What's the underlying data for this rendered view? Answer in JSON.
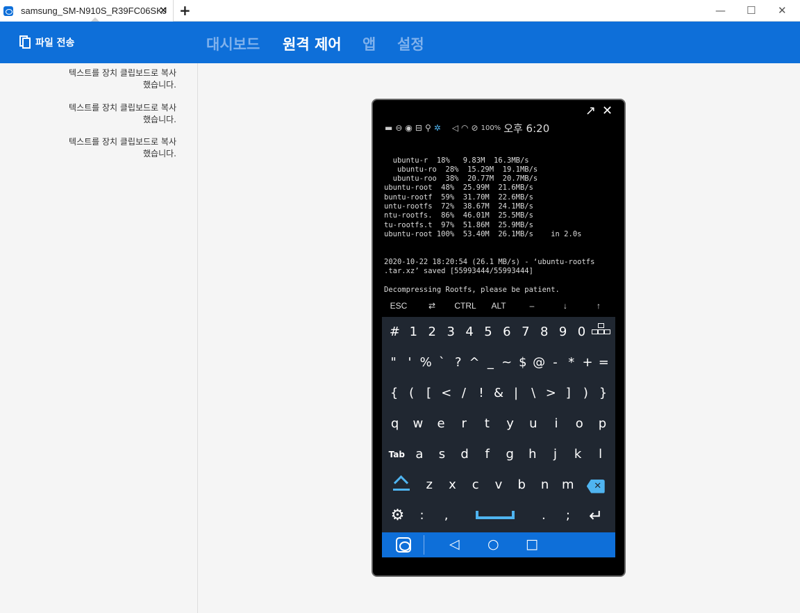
{
  "window": {
    "tab_title": "samsung_SM-N910S_R39FC06SKJ",
    "tab_close": "✕",
    "new_tab": "+",
    "minimize": "—",
    "maximize": "☐",
    "close": "✕"
  },
  "header": {
    "file_transfer_label": "파일 전송",
    "nav": [
      "대시보드",
      "원격 제어",
      "앱",
      "설정"
    ],
    "active_nav": "원격 제어"
  },
  "left_panel": {
    "messages": [
      {
        "line1": "텍스트를 장치 클립보드로 복사",
        "line2": "했습니다."
      },
      {
        "line1": "텍스트를 장치 클립보드로 복사",
        "line2": "했습니다."
      },
      {
        "line1": "텍스트를 장치 클립보드로 복사",
        "line2": "했습니다."
      }
    ]
  },
  "phone": {
    "popout": "↗",
    "close": "✕",
    "status": {
      "battery": "100%",
      "time": "오후 6:20"
    },
    "terminal_lines": [
      "  ubuntu-r  18%   9.83M  16.3MB/s",
      "   ubuntu-ro  28%  15.29M  19.1MB/s",
      "  ubuntu-roo  38%  20.77M  20.7MB/s",
      "ubuntu-root  48%  25.99M  21.6MB/s",
      "buntu-rootf  59%  31.70M  22.6MB/s",
      "untu-rootfs  72%  38.67M  24.1MB/s",
      "ntu-rootfs.  86%  46.01M  25.5MB/s",
      "tu-rootfs.t  97%  51.86M  25.9MB/s",
      "ubuntu-root 100%  53.40M  26.1MB/s    in 2.0s",
      "",
      "",
      "2020-10-22 18:20:54 (26.1 MB/s) - ‘ubuntu-rootfs",
      ".tar.xz’ saved [55993444/55993444]",
      "",
      "Decompressing Rootfs, please be patient."
    ],
    "extra_keys": [
      "ESC",
      "⇄",
      "CTRL",
      "ALT",
      "–",
      "↓",
      "↑"
    ],
    "keyboard": {
      "row1": [
        "#",
        "1",
        "2",
        "3",
        "4",
        "5",
        "6",
        "7",
        "8",
        "9",
        "0"
      ],
      "row2": [
        "\"",
        "'",
        "%",
        "`",
        "?",
        "^",
        "_",
        "~",
        "$",
        "@",
        "-",
        "*",
        "+",
        "="
      ],
      "row3": [
        "{",
        "(",
        "[",
        "<",
        "/",
        "!",
        "&",
        "|",
        "\\",
        ">",
        "]",
        ")",
        "}"
      ],
      "row4": [
        "q",
        "w",
        "e",
        "r",
        "t",
        "y",
        "u",
        "i",
        "o",
        "p"
      ],
      "row5_tab": "Tab",
      "row5": [
        "a",
        "s",
        "d",
        "f",
        "g",
        "h",
        "j",
        "k",
        "l"
      ],
      "row6": [
        "z",
        "x",
        "c",
        "v",
        "b",
        "n",
        "m"
      ],
      "row7_left": [
        ":",
        ","
      ],
      "row7_right": [
        ".",
        ";"
      ],
      "backspace": "✕",
      "settings": "⚙",
      "enter": "↵"
    },
    "navbar": {
      "back": "◁",
      "home": "○",
      "recent": "□"
    }
  },
  "colors": {
    "brand_blue": "#0e6fd9",
    "keyboard_bg": "#202731",
    "key_accent": "#4fb4f0"
  }
}
